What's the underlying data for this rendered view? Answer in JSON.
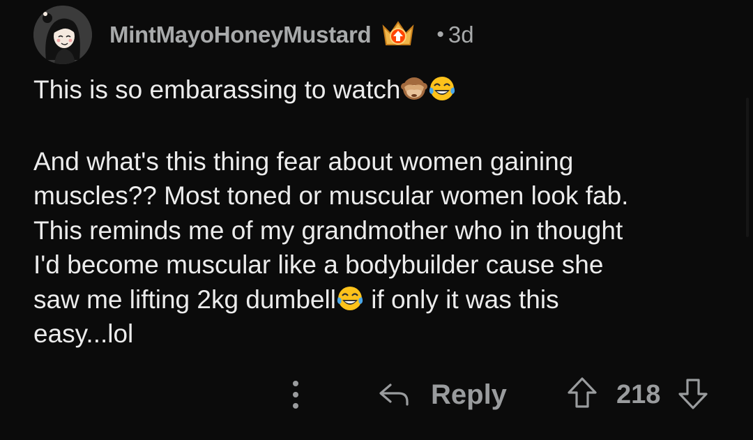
{
  "comment": {
    "author": "MintMayoHoneyMustard",
    "flair_icon": "crown-upvote-badge-icon",
    "separator": "•",
    "age": "3d",
    "avatar_icon": "user-avatar-icon",
    "paragraph1": {
      "text": "This is so embarassing to watch",
      "emojis": [
        "see-no-evil-monkey-icon",
        "tears-of-joy-icon"
      ]
    },
    "paragraph2": {
      "line1": "And what's this thing fear about women gaining",
      "line2": "muscles?? Most toned or muscular women look fab.",
      "line3": "This reminds me of my grandmother who in thought",
      "line4": "I'd become muscular like a bodybuilder cause she",
      "line5_before_emoji": "saw me lifting 2kg dumbell",
      "line5_emoji": "tears-of-joy-icon",
      "line5_after_emoji": " if only it was this",
      "line6": "easy...lol"
    }
  },
  "actions": {
    "more_icon": "more-vertical-icon",
    "reply_icon": "reply-arrow-icon",
    "reply_label": "Reply",
    "upvote_icon": "upvote-arrow-icon",
    "score": "218",
    "downvote_icon": "downvote-arrow-icon"
  },
  "colors": {
    "background": "#0b0b0b",
    "body_text": "#ececec",
    "meta_text": "#a8aaab",
    "action_text": "#9a9c9e"
  }
}
